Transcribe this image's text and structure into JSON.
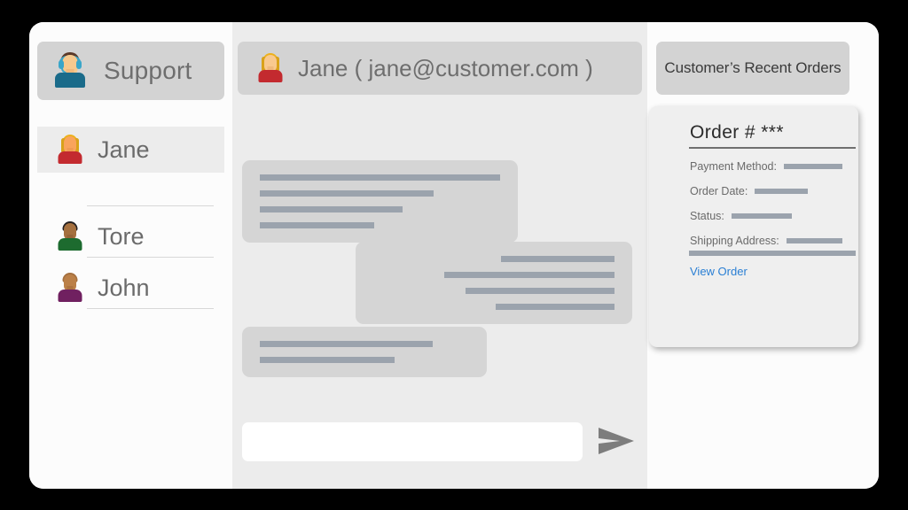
{
  "window": {
    "background_color": "#fcfcfc",
    "outer_background_color": "#000000"
  },
  "sidebar": {
    "header": {
      "label": "Support",
      "avatar": "support-agent-avatar"
    },
    "contacts": [
      {
        "name": "Jane",
        "avatar": "woman-blonde-red-shirt-avatar",
        "active": true
      },
      {
        "name": "Tore",
        "avatar": "man-dark-hair-green-shirt-avatar",
        "active": false
      },
      {
        "name": "John",
        "avatar": "man-brown-hair-purple-shirt-avatar",
        "active": false
      }
    ]
  },
  "chat": {
    "header": {
      "title": "Jane ( jane@customer.com )",
      "customer_name": "Jane",
      "customer_email": "jane@customer.com",
      "avatar": "woman-blonde-red-shirt-avatar"
    },
    "messages": [
      {
        "id": "bubble-1",
        "align": "left",
        "line_widths": [
          271,
          196,
          161,
          129
        ]
      },
      {
        "id": "bubble-2",
        "align": "right",
        "line_widths": [
          128,
          192,
          168,
          134
        ]
      },
      {
        "id": "bubble-3",
        "align": "left",
        "line_widths": [
          195,
          152
        ]
      }
    ],
    "composer": {
      "value": "",
      "placeholder": "",
      "send_icon": "send-paper-plane-icon"
    }
  },
  "orders": {
    "header_title": "Customer’s Recent Orders",
    "card": {
      "order_number": "Order # ***",
      "fields": [
        {
          "label": "Payment Method:",
          "value_width": 72
        },
        {
          "label": "Order Date:",
          "value_width": 60
        },
        {
          "label": "Status:",
          "value_width": 68
        },
        {
          "label": "Shipping Address:",
          "value_width": 68
        }
      ],
      "address_second_line_width": 188,
      "view_order_label": "View Order",
      "link_color": "#2a7fd4"
    }
  },
  "colors": {
    "panel_header": "#d3d3d3",
    "chat_background": "#ececec",
    "bubble": "#d5d5d5",
    "placeholder_line": "#9ba3ad",
    "text_grey": "#6e6e6e",
    "link_blue": "#2a7fd4",
    "card_background": "#efefef"
  }
}
